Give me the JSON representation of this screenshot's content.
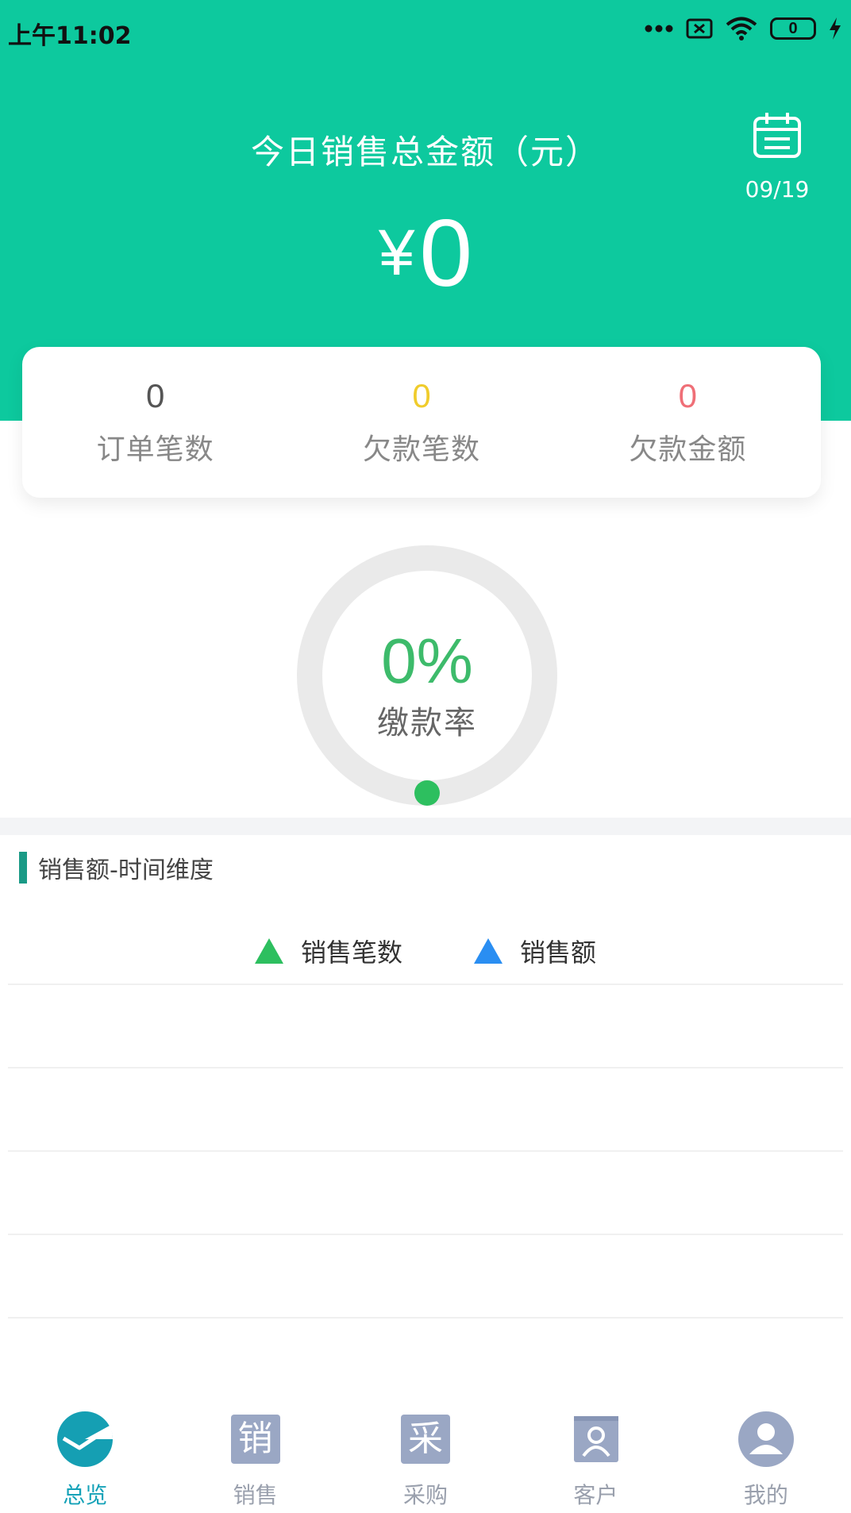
{
  "status_bar": {
    "time": "上午11:02",
    "battery_level": "0"
  },
  "header": {
    "title": "今日销售总金额（元）",
    "currency_symbol": "¥",
    "amount": "0",
    "date": "09/19",
    "background_color": "#0dc99e"
  },
  "stats": [
    {
      "value": "0",
      "label": "订单笔数",
      "color": "#555555"
    },
    {
      "value": "0",
      "label": "欠款笔数",
      "color": "#f0cc2c"
    },
    {
      "value": "0",
      "label": "欠款金额",
      "color": "#ef6f77"
    }
  ],
  "payment_rate": {
    "value": "0%",
    "label": "缴款率",
    "fraction": 0
  },
  "section": {
    "title": "销售额-时间维度"
  },
  "legend": [
    {
      "label": "销售笔数",
      "color": "#2dbf5f"
    },
    {
      "label": "销售额",
      "color": "#2a8ef2"
    }
  ],
  "bottom_nav": [
    {
      "label": "总览",
      "icon": "pie-chart-icon",
      "active": true
    },
    {
      "label": "销售",
      "icon": "sales-tile-icon",
      "glyph": "销",
      "active": false
    },
    {
      "label": "采购",
      "icon": "purchase-tile-icon",
      "glyph": "采",
      "active": false
    },
    {
      "label": "客户",
      "icon": "contacts-book-icon",
      "active": false
    },
    {
      "label": "我的",
      "icon": "user-avatar-icon",
      "active": false
    }
  ]
}
